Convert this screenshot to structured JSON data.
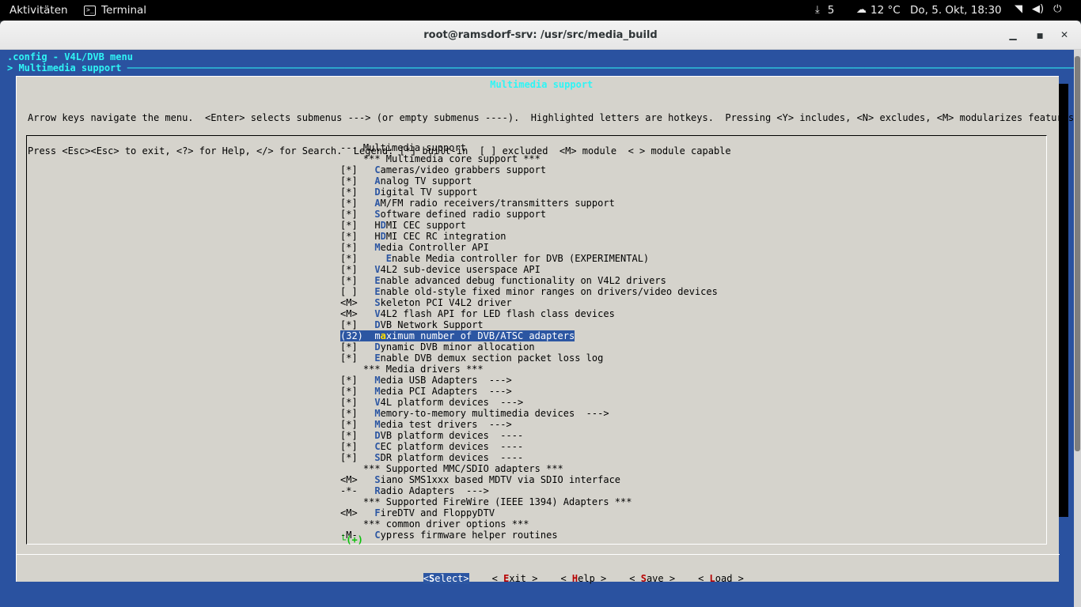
{
  "topbar": {
    "activities": "Aktivitäten",
    "app_name": "Terminal",
    "tray_count": "5",
    "weather": "12 °C",
    "clock": "Do,  5. Okt, 18:30"
  },
  "window": {
    "title": "root@ramsdorf-srv: /usr/src/media_build"
  },
  "terminal": {
    "line1": ".config - V4L/DVB menu",
    "line2": "> Multimedia support ────────────────────────────────────────────────────────────────────────────────────────────────────────────────────────────────────────────────────────────────────────"
  },
  "dialog": {
    "title": " Multimedia support ",
    "help_line1": "Arrow keys navigate the menu.  <Enter> selects submenus ---> (or empty submenus ----).  Highlighted letters are hotkeys.  Pressing <Y> includes, <N> excludes, <M> modularizes features.",
    "help_line2": "Press <Esc><Esc> to exit, <?> for Help, </> for Search.  Legend: [*] built-in  [ ] excluded  <M> module  < > module capable",
    "more_indicator": "└(+)"
  },
  "menu": {
    "items": [
      {
        "prefix": "--- ",
        "hotkey": "",
        "text": "Multimedia support"
      },
      {
        "prefix": "    ",
        "hotkey": "",
        "text": "*** Multimedia core support ***"
      },
      {
        "prefix": "[*]   ",
        "hotkey": "C",
        "text": "ameras/video grabbers support"
      },
      {
        "prefix": "[*]   ",
        "hotkey": "A",
        "text": "nalog TV support"
      },
      {
        "prefix": "[*]   ",
        "hotkey": "D",
        "text": "igital TV support"
      },
      {
        "prefix": "[*]   ",
        "hotkey": "A",
        "text": "M/FM radio receivers/transmitters support"
      },
      {
        "prefix": "[*]   ",
        "hotkey": "S",
        "text": "oftware defined radio support"
      },
      {
        "prefix": "[*]   H",
        "hotkey": "D",
        "text": "MI CEC support"
      },
      {
        "prefix": "[*]   H",
        "hotkey": "D",
        "text": "MI CEC RC integration"
      },
      {
        "prefix": "[*]   ",
        "hotkey": "M",
        "text": "edia Controller API"
      },
      {
        "prefix": "[*]     ",
        "hotkey": "E",
        "text": "nable Media controller for DVB (EXPERIMENTAL)"
      },
      {
        "prefix": "[*]   ",
        "hotkey": "V",
        "text": "4L2 sub-device userspace API"
      },
      {
        "prefix": "[*]   ",
        "hotkey": "E",
        "text": "nable advanced debug functionality on V4L2 drivers"
      },
      {
        "prefix": "[ ]   ",
        "hotkey": "E",
        "text": "nable old-style fixed minor ranges on drivers/video devices"
      },
      {
        "prefix": "<M>   ",
        "hotkey": "S",
        "text": "keleton PCI V4L2 driver"
      },
      {
        "prefix": "<M>   ",
        "hotkey": "V",
        "text": "4L2 flash API for LED flash class devices"
      },
      {
        "prefix": "[*]   ",
        "hotkey": "D",
        "text": "VB Network Support"
      },
      {
        "prefix": "(32)  m",
        "hotkey": "a",
        "text": "ximum number of DVB/ATSC adapters"
      },
      {
        "prefix": "[*]   ",
        "hotkey": "D",
        "text": "ynamic DVB minor allocation"
      },
      {
        "prefix": "[*]   ",
        "hotkey": "E",
        "text": "nable DVB demux section packet loss log"
      },
      {
        "prefix": "    ",
        "hotkey": "",
        "text": "*** Media drivers ***"
      },
      {
        "prefix": "[*]   ",
        "hotkey": "M",
        "text": "edia USB Adapters  --->"
      },
      {
        "prefix": "[*]   ",
        "hotkey": "M",
        "text": "edia PCI Adapters  --->"
      },
      {
        "prefix": "[*]   ",
        "hotkey": "V",
        "text": "4L platform devices  --->"
      },
      {
        "prefix": "[*]   ",
        "hotkey": "M",
        "text": "emory-to-memory multimedia devices  --->"
      },
      {
        "prefix": "[*]   ",
        "hotkey": "M",
        "text": "edia test drivers  --->"
      },
      {
        "prefix": "[*]   ",
        "hotkey": "D",
        "text": "VB platform devices  ----"
      },
      {
        "prefix": "[*]   ",
        "hotkey": "C",
        "text": "EC platform devices  ----"
      },
      {
        "prefix": "[*]   ",
        "hotkey": "S",
        "text": "DR platform devices  ----"
      },
      {
        "prefix": "    ",
        "hotkey": "",
        "text": "*** Supported MMC/SDIO adapters ***"
      },
      {
        "prefix": "<M>   ",
        "hotkey": "S",
        "text": "iano SMS1xxx based MDTV via SDIO interface"
      },
      {
        "prefix": "-*-   ",
        "hotkey": "R",
        "text": "adio Adapters  --->"
      },
      {
        "prefix": "    ",
        "hotkey": "",
        "text": "*** Supported FireWire (IEEE 1394) Adapters ***"
      },
      {
        "prefix": "<M>   ",
        "hotkey": "F",
        "text": "ireDTV and FloppyDTV"
      },
      {
        "prefix": "    ",
        "hotkey": "",
        "text": "*** common driver options ***"
      },
      {
        "prefix": "-M-   ",
        "hotkey": "C",
        "text": "ypress firmware helper routines"
      }
    ],
    "selected_index": 17
  },
  "buttons": {
    "select": {
      "pre": "<",
      "hk": "S",
      "post": "elect>"
    },
    "exit": {
      "pre": "< ",
      "hk": "E",
      "post": "xit >"
    },
    "help": {
      "pre": "< ",
      "hk": "H",
      "post": "elp >"
    },
    "save": {
      "pre": "< ",
      "hk": "S",
      "post": "ave >"
    },
    "load": {
      "pre": "< ",
      "hk": "L",
      "post": "oad >"
    }
  }
}
